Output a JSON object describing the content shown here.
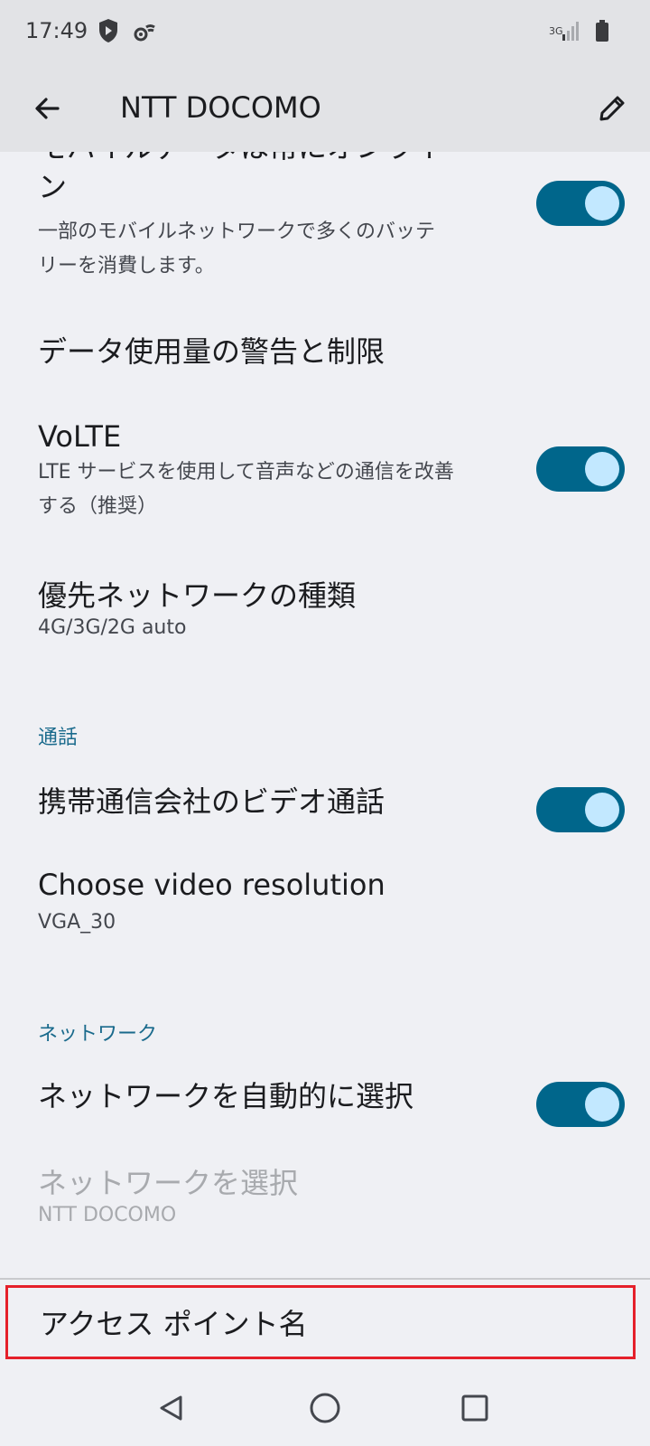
{
  "status_bar": {
    "time": "17:49",
    "network_label": "3G",
    "icons": [
      "shield-icon",
      "wifi-settings-icon",
      "signal-icon",
      "battery-icon"
    ]
  },
  "app_bar": {
    "title": "NTT DOCOMO",
    "back_icon": "arrow-back-icon",
    "edit_icon": "pencil-icon"
  },
  "settings": {
    "mobile_data_always_on": {
      "title_partial": "モバイルデータは常にオンライ",
      "title_tail": "ン",
      "summary": "一部のモバイルネットワークで多くのバッテ",
      "summary_2": "リーを消費します。",
      "enabled": true
    },
    "data_warning": {
      "title": "データ使用量の警告と制限"
    },
    "volte": {
      "title": "VoLTE",
      "summary": "LTE サービスを使用して音声などの通信を改善",
      "summary_2": "する（推奨）",
      "enabled": true
    },
    "preferred_network": {
      "title": "優先ネットワークの種類",
      "summary": "4G/3G/2G auto"
    },
    "section_call": "通話",
    "carrier_video_call": {
      "title": "携帯通信会社のビデオ通話",
      "enabled": true
    },
    "video_resolution": {
      "title": "Choose video resolution",
      "summary": "VGA_30"
    },
    "section_network": "ネットワーク",
    "auto_select_network": {
      "title": "ネットワークを自動的に選択",
      "enabled": true
    },
    "select_network": {
      "title": "ネットワークを選択",
      "summary": "NTT DOCOMO"
    },
    "access_point_names": {
      "title": "アクセス ポイント名"
    }
  },
  "colors": {
    "accent": "#00668b",
    "toggle_thumb": "#c2e8ff",
    "section_header": "#1a6a8c",
    "highlight": "#e5202a"
  },
  "nav_bar": {
    "icons": [
      "back-triangle-icon",
      "home-circle-icon",
      "recents-square-icon"
    ]
  }
}
